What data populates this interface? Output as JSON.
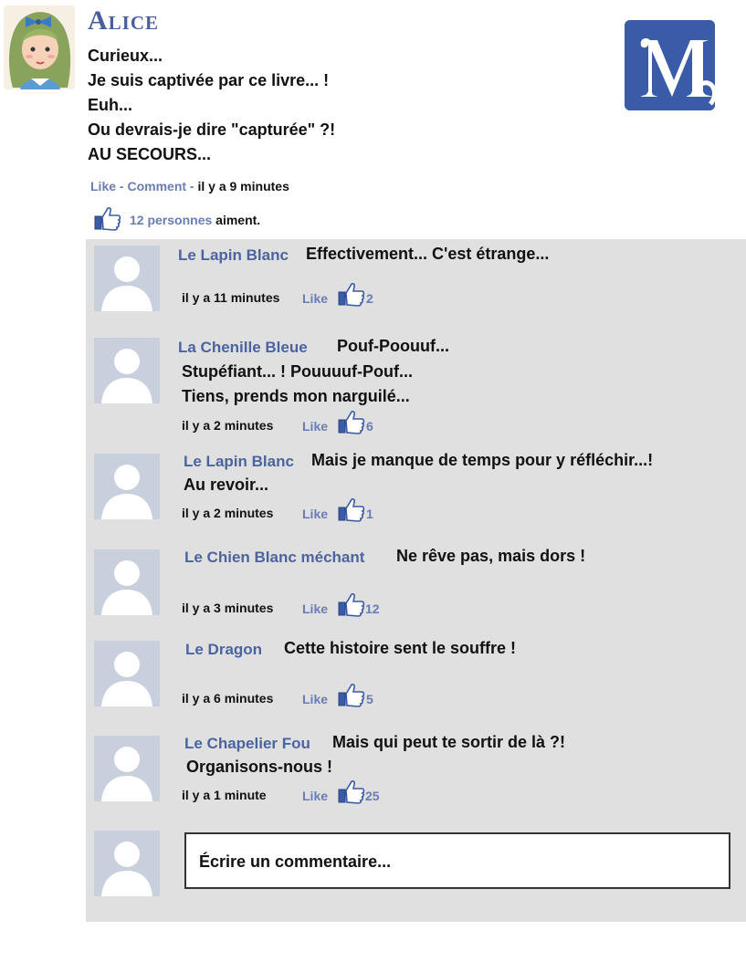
{
  "post": {
    "author": "Alice",
    "lines": [
      "Curieux...",
      "Je suis captivée par ce livre... !",
      "Euh...",
      "Ou devrais-je dire \"capturée\" ?!",
      "AU SECOURS..."
    ],
    "like_label": "Like",
    "comment_label": "Comment",
    "separator": " - ",
    "time": "il y a 9 minutes",
    "likes_people": "12 personnes",
    "likes_suffix": " aiment.",
    "logo_letter": "M"
  },
  "comments": [
    {
      "name": "Le Lapin Blanc",
      "text_lines": [
        "Effectivement... C'est étrange..."
      ],
      "time": "il y a 11 minutes",
      "like_label": "Like",
      "like_count": "2"
    },
    {
      "name": "La Chenille Bleue",
      "text_lines": [
        "Pouf-Poouuf...",
        "Stupéfiant... ! Pouuuuf-Pouf...",
        "Tiens, prends mon narguilé..."
      ],
      "time": "il y a 2 minutes",
      "like_label": "Like",
      "like_count": "6"
    },
    {
      "name": "Le Lapin Blanc",
      "text_lines": [
        "Mais je manque de temps pour y réfléchir...!",
        "Au revoir..."
      ],
      "time": "il y a 2 minutes",
      "like_label": "Like",
      "like_count": "1"
    },
    {
      "name": "Le Chien Blanc méchant",
      "text_lines": [
        "Ne rêve pas, mais dors !"
      ],
      "time": "il y a 3 minutes",
      "like_label": "Like",
      "like_count": "12"
    },
    {
      "name": "Le Dragon",
      "text_lines": [
        "Cette histoire sent le souffre !"
      ],
      "time": "il y a 6 minutes",
      "like_label": "Like",
      "like_count": "5"
    },
    {
      "name": "Le Chapelier Fou",
      "text_lines": [
        "Mais qui peut te sortir de là ?!",
        "Organisons-nous !"
      ],
      "time": "il y a 1 minute",
      "like_label": "Like",
      "like_count": "25"
    }
  ],
  "composer": {
    "placeholder": "Écrire un commentaire..."
  },
  "colors": {
    "accent": "#4b64a0",
    "link": "#6a7db3",
    "panel": "#e0e0e0",
    "logo": "#3a5ba8"
  }
}
